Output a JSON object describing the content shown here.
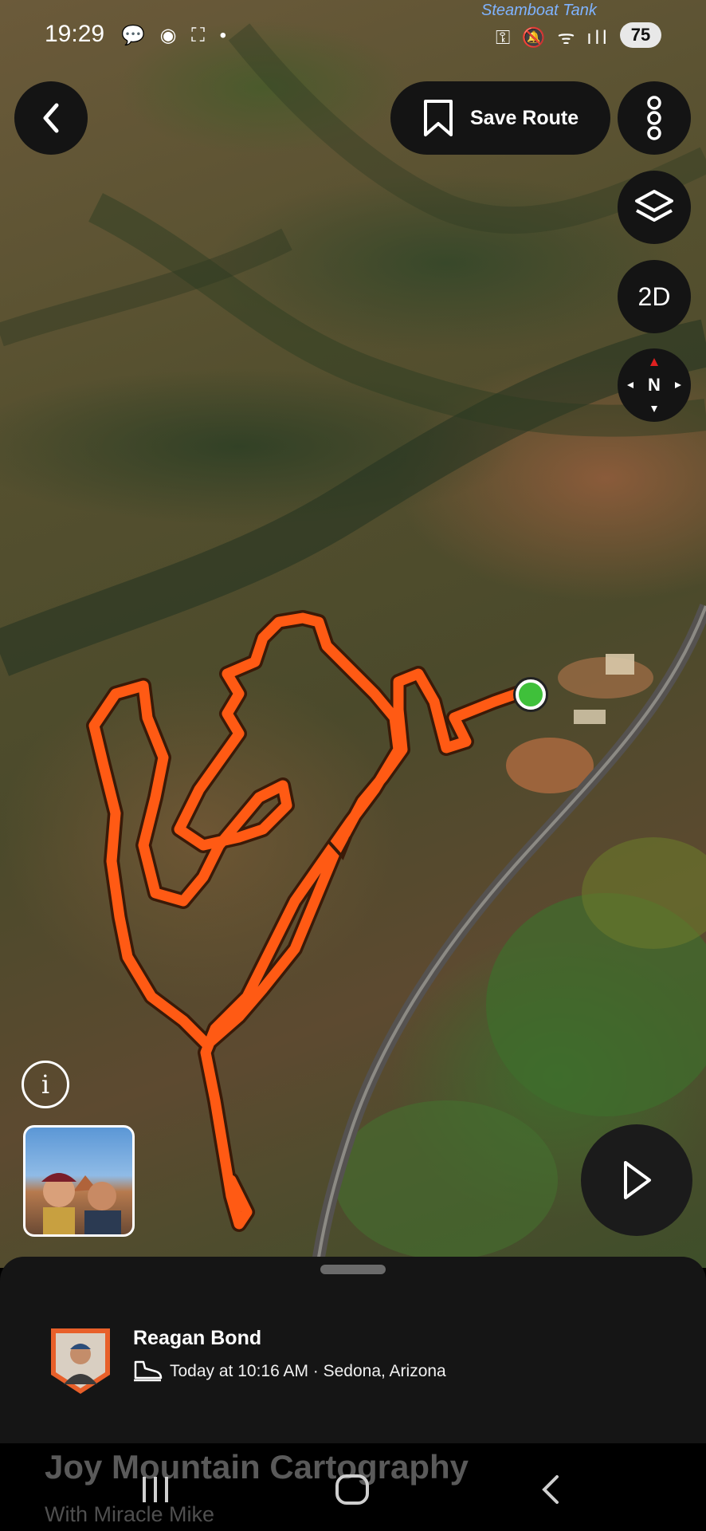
{
  "status_bar": {
    "time": "19:29",
    "left_icons": "💬 ◉ ⛶ •",
    "right_icons": "⚿ 🔕 ᯤ ıll",
    "battery": "75"
  },
  "map": {
    "place_label": "Steamboat Tank"
  },
  "toolbar": {
    "back_icon": "chevron-left-icon",
    "save_label": "Save Route",
    "more_icon": "more-vertical-icon",
    "layers_icon": "layers-icon",
    "view_mode_label": "2D",
    "compass_label": "N"
  },
  "controls": {
    "info_label": "i",
    "play_icon": "play-icon"
  },
  "activity": {
    "author": "Reagan Bond",
    "meta": "Today at 10:16 AM · Sedona, Arizona",
    "activity_icon": "hiking-shoe-icon"
  },
  "background_text": {
    "title": "Joy Mountain Cartography",
    "subtitle": "With Miracle Mike"
  },
  "nav_bar": {
    "recents_icon": "recents-icon",
    "home_icon": "home-icon",
    "back_icon": "back-icon"
  },
  "colors": {
    "route": "#ff5a14",
    "route_outline": "#3a1a08",
    "start_marker": "#3fc03a",
    "button_bg": "#141414",
    "sheet_bg": "#151515"
  }
}
